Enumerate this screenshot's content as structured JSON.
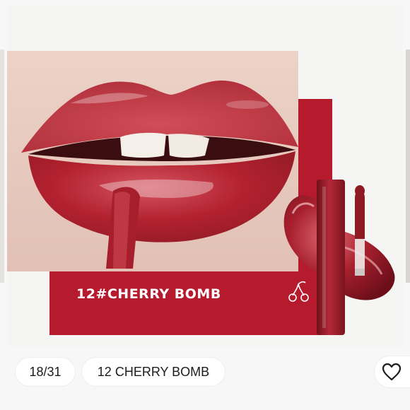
{
  "slide": {
    "shade_label": "12#CHERRY BOMB",
    "counter": "18/31",
    "caption": "12 CHERRY BOMB"
  },
  "icons": {
    "like": "heart-outline-icon",
    "cherry": "cherry-icon"
  },
  "colors": {
    "banner": "#b51a2d",
    "lip": "#b8313b",
    "product": "#8e1a24",
    "pill_bg": "#ffffff",
    "text": "#1c1c1c"
  }
}
